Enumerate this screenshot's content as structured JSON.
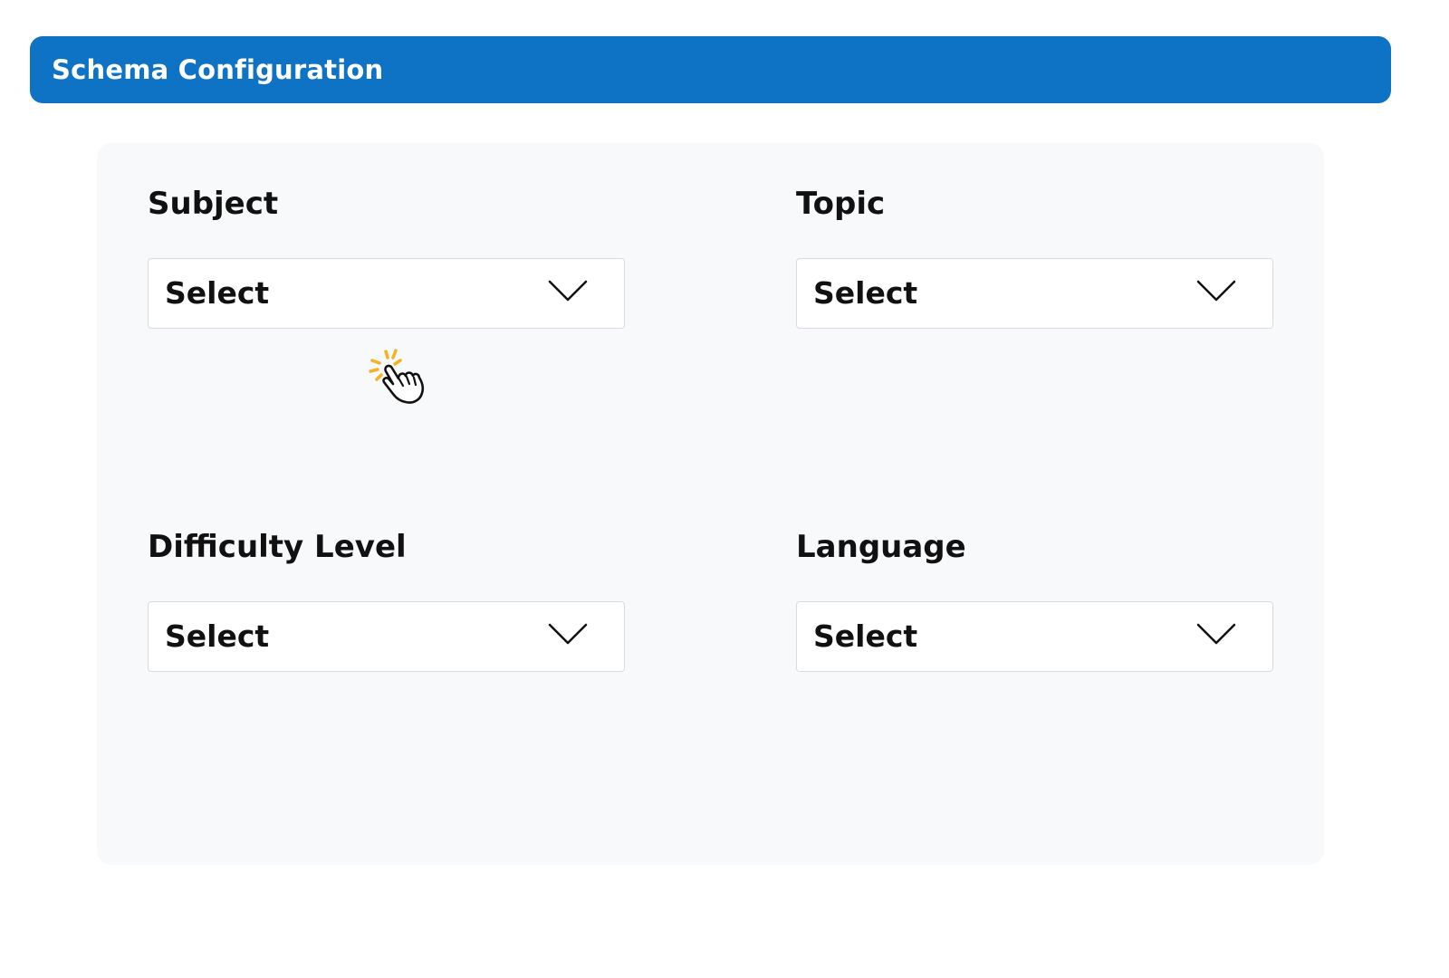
{
  "header": {
    "title": "Schema Configuration",
    "color": "#0e73c4"
  },
  "fields": [
    {
      "label": "Subject",
      "value": "Select"
    },
    {
      "label": "Topic",
      "value": "Select"
    },
    {
      "label": "Difficulty Level",
      "value": "Select"
    },
    {
      "label": "Language",
      "value": "Select"
    }
  ],
  "icons": {
    "dropdown": "chevron-down-icon",
    "cursor": "hand-pointer-click-icon"
  }
}
